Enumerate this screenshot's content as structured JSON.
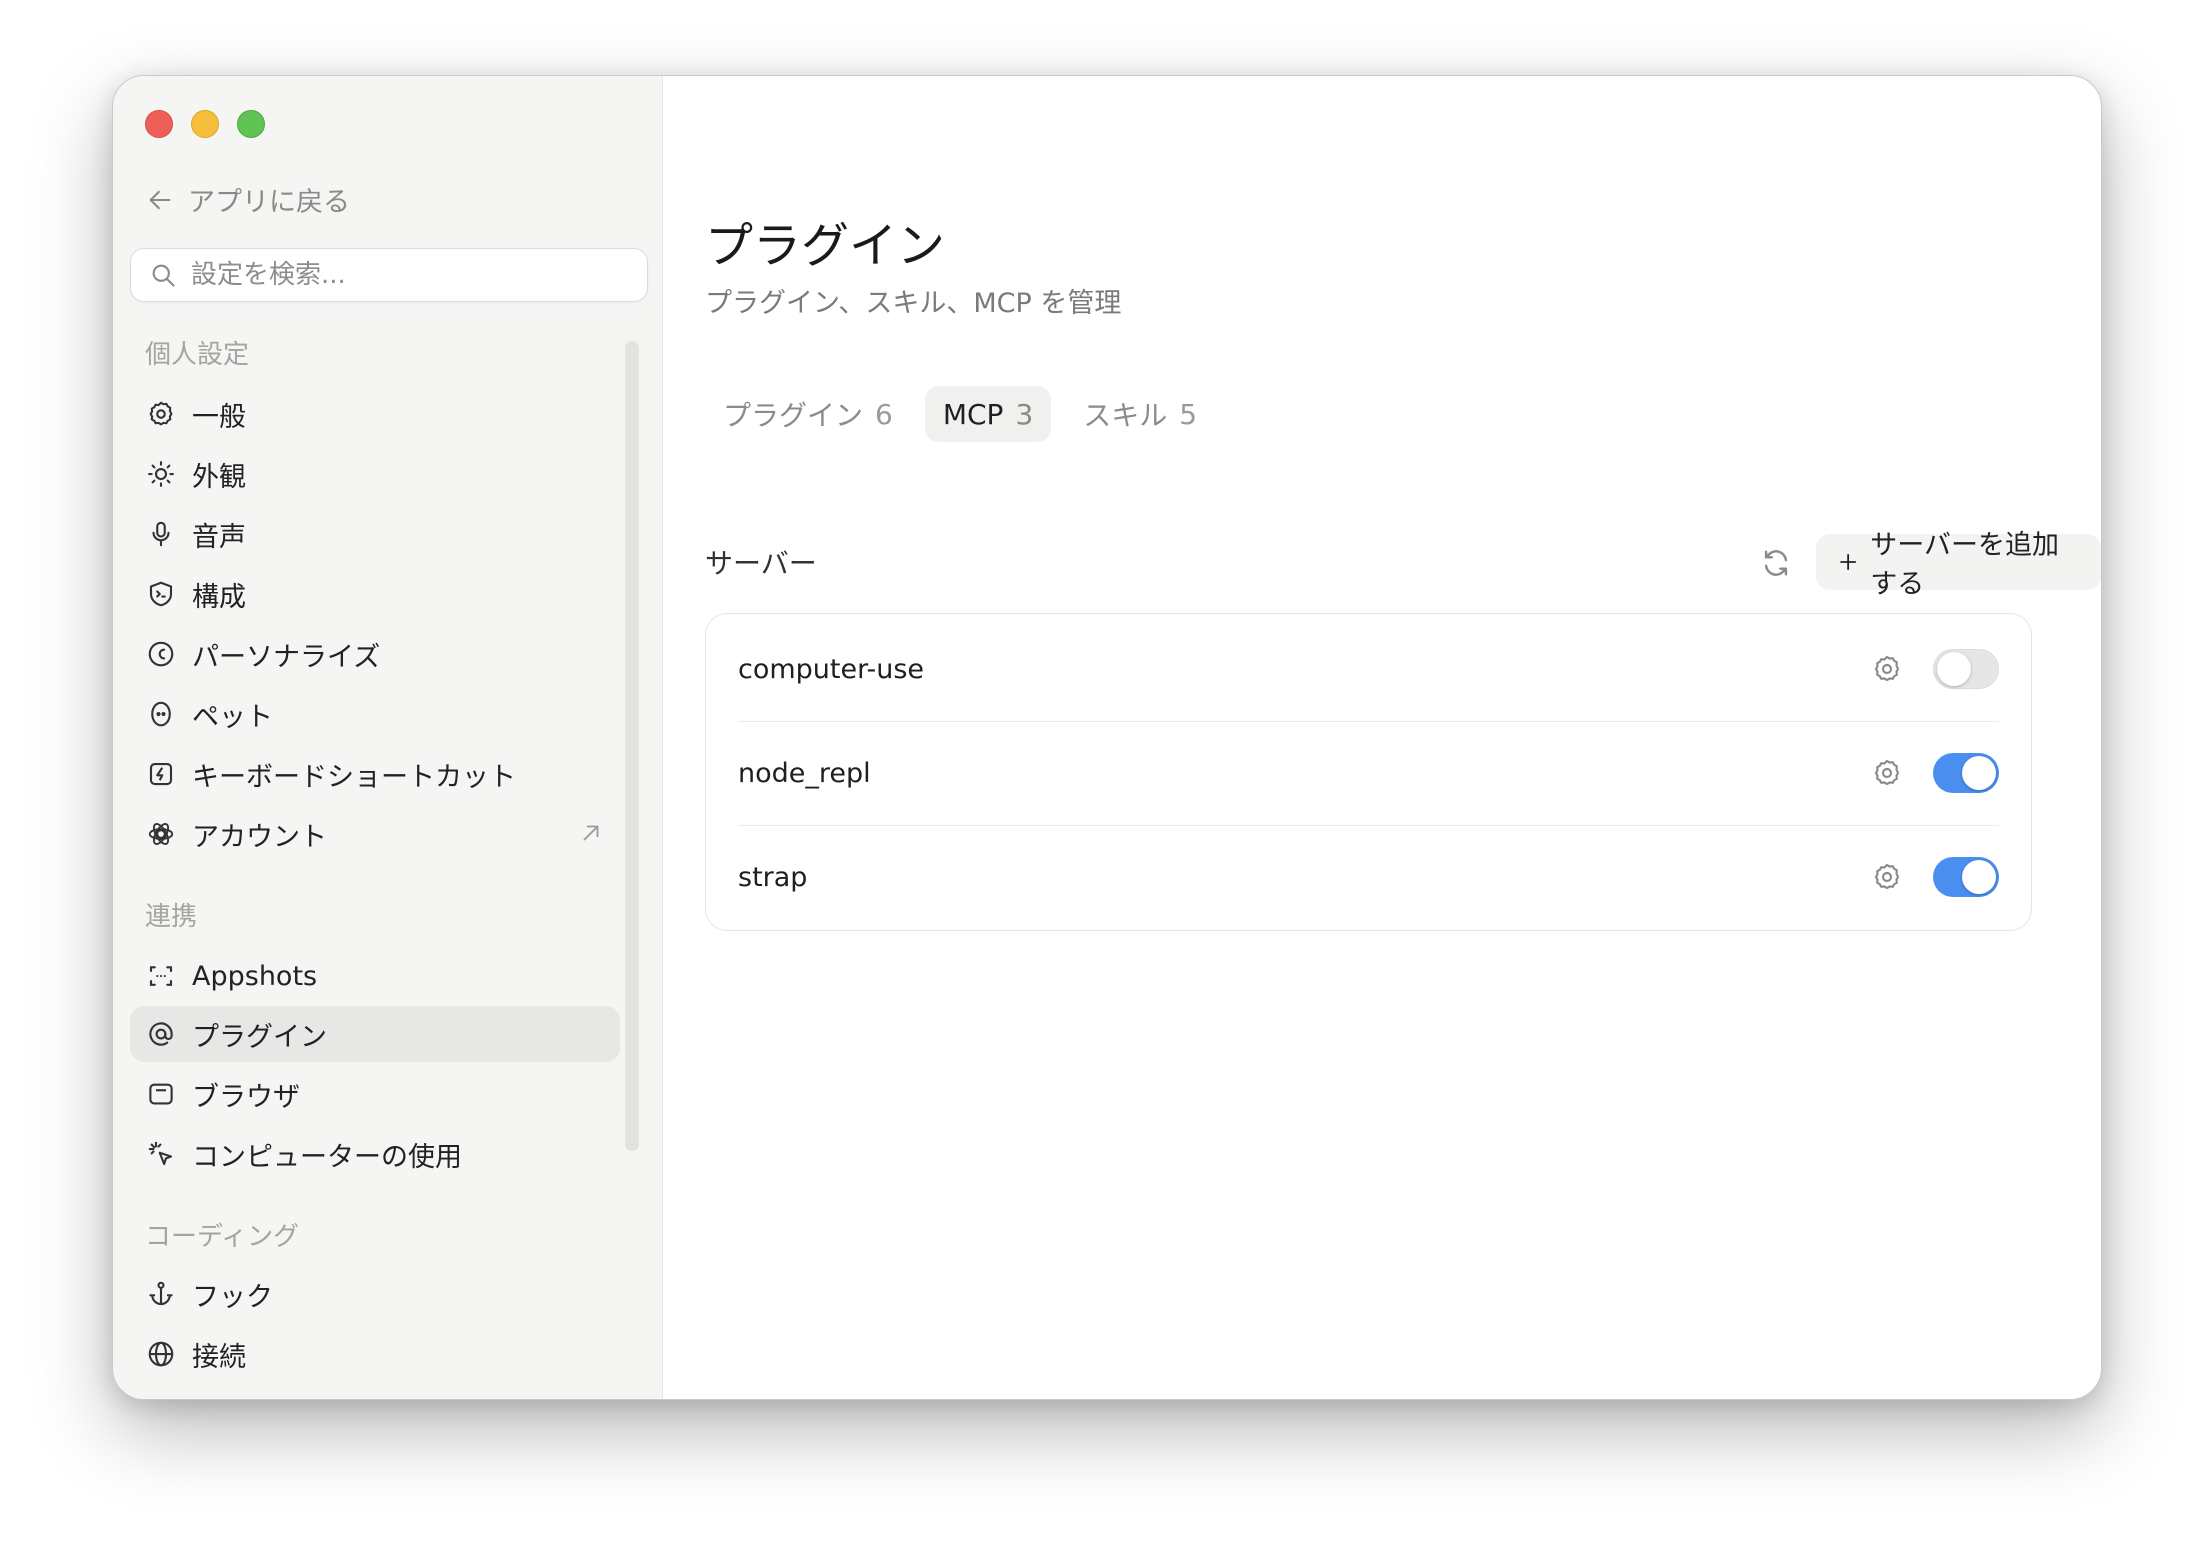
{
  "sidebar": {
    "back_label": "アプリに戻る",
    "search_placeholder": "設定を検索...",
    "sections": {
      "personal": "個人設定",
      "integrations": "連携",
      "coding": "コーディング"
    },
    "personal_items": [
      {
        "label": "一般",
        "icon": "gear-icon"
      },
      {
        "label": "外観",
        "icon": "sun-icon"
      },
      {
        "label": "音声",
        "icon": "microphone-icon"
      },
      {
        "label": "構成",
        "icon": "shield-terminal-icon"
      },
      {
        "label": "パーソナライズ",
        "icon": "personalize-icon"
      },
      {
        "label": "ペット",
        "icon": "pet-icon"
      },
      {
        "label": "キーボードショートカット",
        "icon": "lightning-icon"
      },
      {
        "label": "アカウント",
        "icon": "account-logo-icon"
      }
    ],
    "integration_items": [
      {
        "label": "Appshots",
        "icon": "screenshot-icon"
      },
      {
        "label": "プラグイン",
        "icon": "at-icon",
        "active": true
      },
      {
        "label": "ブラウザ",
        "icon": "browser-icon"
      },
      {
        "label": "コンピューターの使用",
        "icon": "cursor-click-icon"
      }
    ],
    "coding_items": [
      {
        "label": "フック",
        "icon": "anchor-icon"
      },
      {
        "label": "接続",
        "icon": "globe-icon"
      }
    ]
  },
  "main": {
    "title": "プラグイン",
    "subtitle": "プラグイン、スキル、MCP を管理",
    "tabs": [
      {
        "label": "プラグイン",
        "count": "6"
      },
      {
        "label": "MCP",
        "count": "3",
        "active": true
      },
      {
        "label": "スキル",
        "count": "5"
      }
    ],
    "servers_label": "サーバー",
    "add_server_label": "サーバーを追加する",
    "servers": [
      {
        "name": "computer-use",
        "enabled": false
      },
      {
        "name": "node_repl",
        "enabled": true
      },
      {
        "name": "strap",
        "enabled": true
      }
    ]
  },
  "colors": {
    "accent": "#4a8ef0",
    "sidebar_bg": "#f5f5f4",
    "active_item_bg": "#e7e7e5"
  }
}
